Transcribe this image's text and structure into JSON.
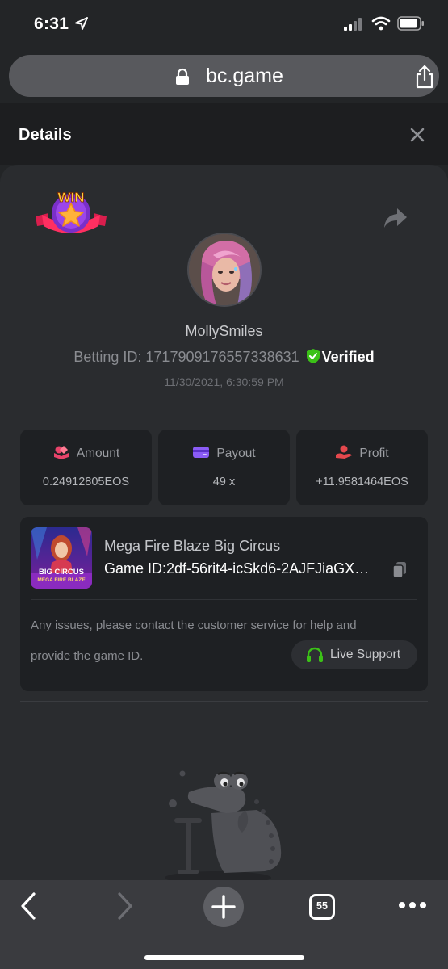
{
  "status_bar": {
    "time": "6:31"
  },
  "browser": {
    "url": "bc.game",
    "tab_count": "55"
  },
  "modal": {
    "title": "Details"
  },
  "player": {
    "username": "MollySmiles",
    "betting_id_label": "Betting ID:",
    "betting_id": "1717909176557338631",
    "verified_label": "Verified",
    "timestamp": "11/30/2021, 6:30:59 PM",
    "badge_text": "WIN"
  },
  "stats": [
    {
      "label": "Amount",
      "value": "0.24912805EOS",
      "icon": "coins-icon"
    },
    {
      "label": "Payout",
      "value": "49 x",
      "icon": "card-icon"
    },
    {
      "label": "Profit",
      "value": "+11.9581464EOS",
      "icon": "hand-coin-icon"
    }
  ],
  "game": {
    "name": "Mega Fire Blaze Big Circus",
    "id_label": "Game ID:",
    "id_value": "2df-56rit4-icSkd6-2AJFJiaGX…",
    "thumb_line1": "BIG CIRCUS",
    "thumb_line2": "MEGA FIRE BLAZE",
    "note_line1": "Any issues, please contact the customer service for help and",
    "note_line2": "provide the game ID.",
    "support_label": "Live Support"
  },
  "colors": {
    "accent_green": "#3bc117",
    "amount_icon": "#e8436a",
    "payout_icon": "#8b5cf6",
    "profit_icon": "#e5484d"
  }
}
